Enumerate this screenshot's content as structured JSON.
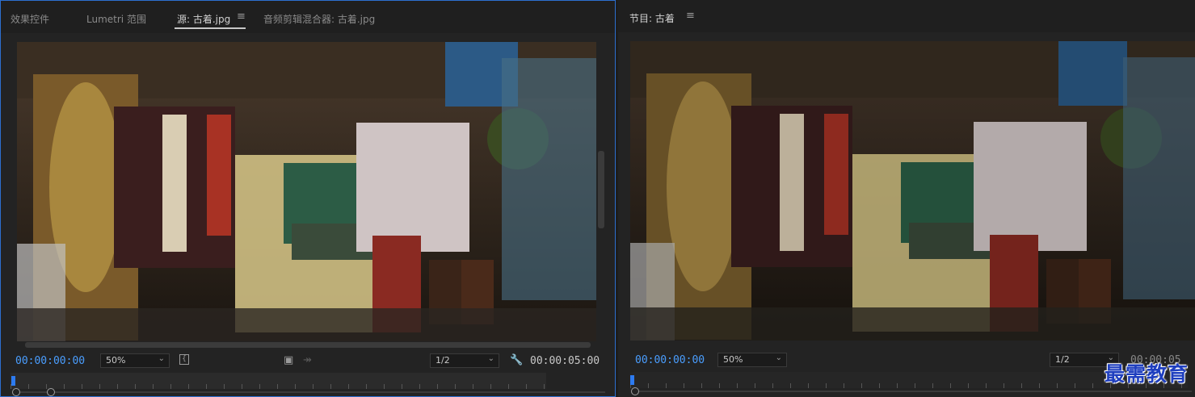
{
  "source_panel": {
    "tabs": [
      {
        "label": "效果控件"
      },
      {
        "label": "Lumetri 范围"
      },
      {
        "label": "源: 古着.jpg"
      },
      {
        "label": "音频剪辑混合器: 古着.jpg"
      }
    ],
    "active_tab": "源: 古着.jpg",
    "current_timecode": "00:00:00:00",
    "zoom": "50%",
    "resolution": "1/2",
    "duration_timecode": "00:00:05:00"
  },
  "program_panel": {
    "title": "节目: 古着",
    "current_timecode": "00:00:00:00",
    "zoom": "50%",
    "resolution": "1/2",
    "duration_timecode": "00:00:05"
  },
  "icons": {
    "panel_menu": "hamburger-icon",
    "mark": "bracket-icon",
    "export_frame": "camera-icon",
    "insert": "insert-icon",
    "settings": "wrench-icon"
  },
  "colors": {
    "accent": "#4a9eff",
    "active_border": "#2d6fd0",
    "playhead": "#2d7bf0"
  },
  "watermark": "最需教育"
}
